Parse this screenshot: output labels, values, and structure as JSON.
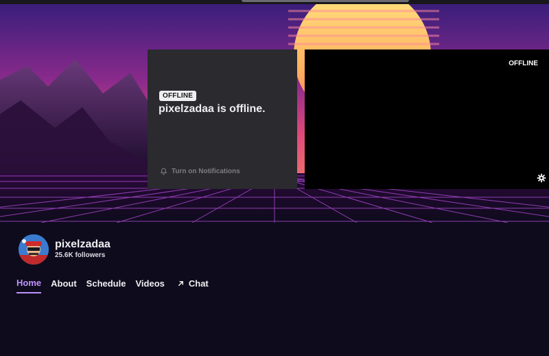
{
  "offline_card": {
    "badge": "OFFLINE",
    "title": "pixelzadaa is offline.",
    "notify_label": "Turn on Notifications"
  },
  "player": {
    "status": "OFFLINE"
  },
  "channel": {
    "name": "pixelzadaa",
    "followers": "25.6K followers"
  },
  "tabs": [
    {
      "label": "Home",
      "active": true
    },
    {
      "label": "About"
    },
    {
      "label": "Schedule"
    },
    {
      "label": "Videos"
    },
    {
      "label": "Chat",
      "icon": "arrow-up-right-icon"
    }
  ],
  "colors": {
    "accent": "#bf94ff",
    "page_bg": "#0e0b1c",
    "card_bg": "#2a2a2f"
  }
}
